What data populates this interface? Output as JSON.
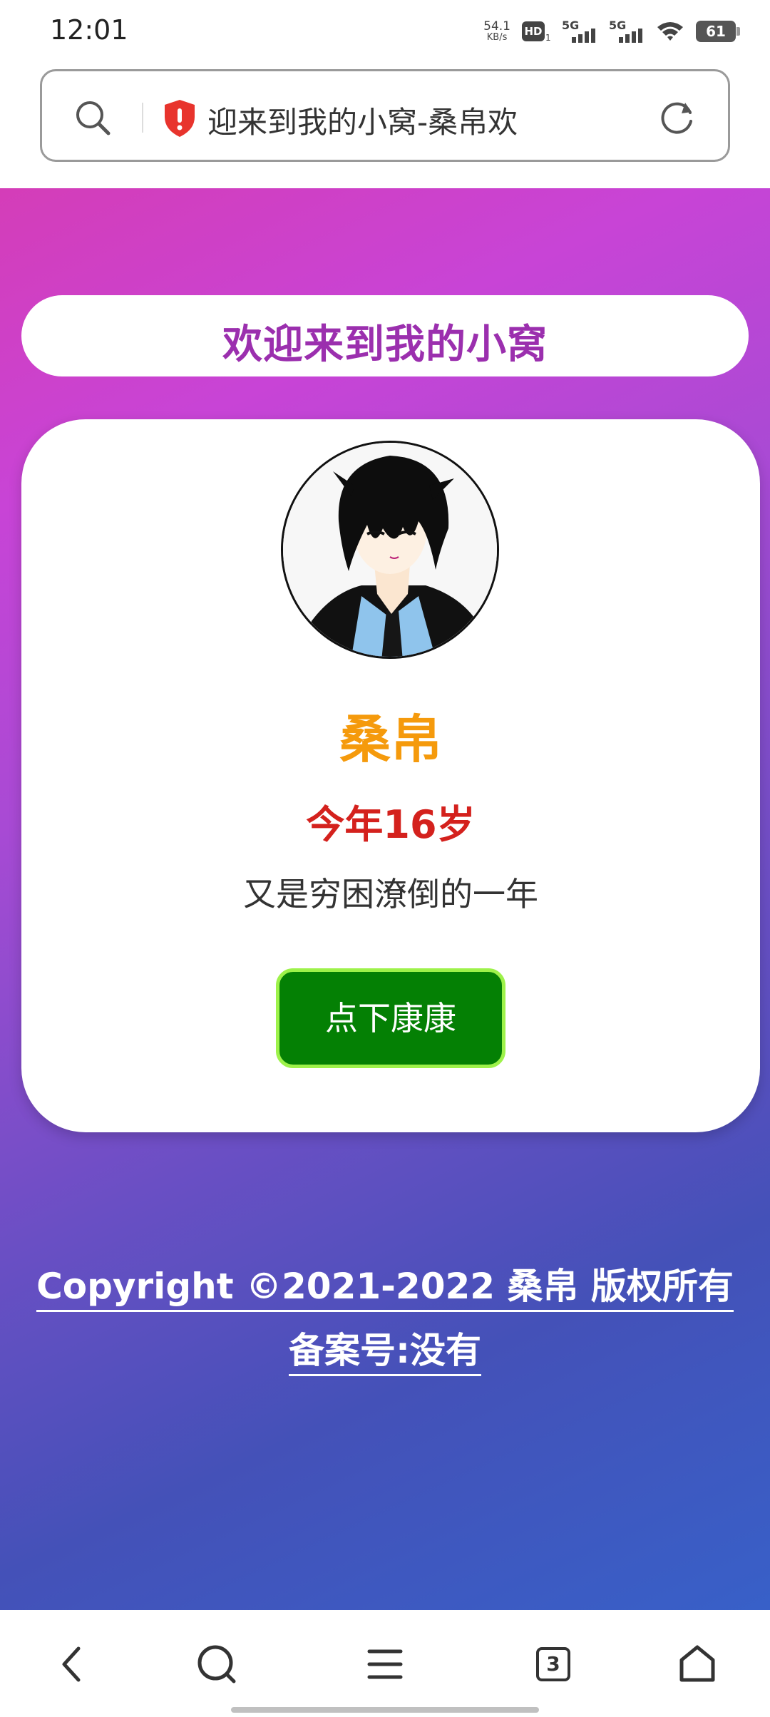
{
  "status_bar": {
    "time": "12:01",
    "net_speed_value": "54.1",
    "net_speed_unit": "KB/s",
    "hd_label": "HD",
    "hd_sub": "1",
    "signal_1_label": "5G",
    "signal_2_label": "5G",
    "battery_level": "61"
  },
  "address_bar": {
    "page_title": "迎来到我的小窝-桑帛欢",
    "icons": [
      "search-icon",
      "shield-alert-icon",
      "reload-icon"
    ]
  },
  "page": {
    "welcome": "欢迎来到我的小窝",
    "profile": {
      "name": "桑帛",
      "age": "今年16岁",
      "motto": "又是穷困潦倒的一年",
      "button_label": "点下康康"
    },
    "footer": {
      "copyright": "Copyright ©2021-2022 桑帛 版权所有",
      "icp": "备案号:没有"
    },
    "colors": {
      "welcome_text": "#9b2fae",
      "name": "#f59a0c",
      "age": "#d4211d",
      "button_bg": "#048004",
      "button_border": "#9df24a",
      "gradient_start": "#d43db8",
      "gradient_end": "#3860c8"
    }
  },
  "bottom_nav": {
    "tab_count": "3",
    "icons": [
      "back-icon",
      "search-icon",
      "menu-icon",
      "tabs-icon",
      "home-icon"
    ]
  }
}
